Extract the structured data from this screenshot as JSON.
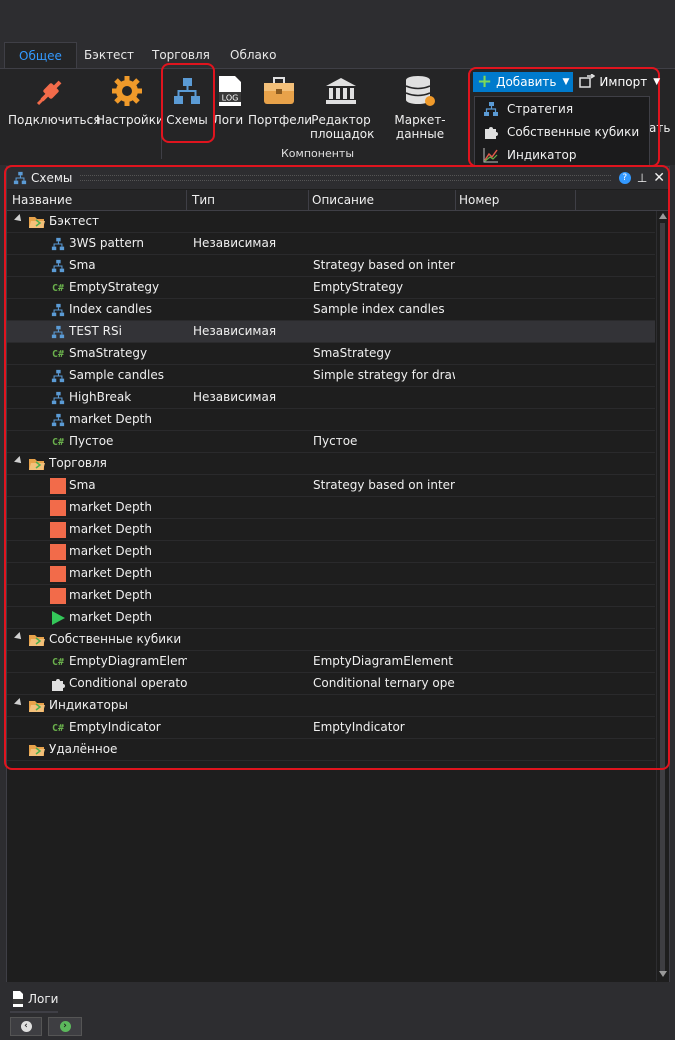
{
  "tabs": [
    {
      "label": "Общее",
      "active": true
    },
    {
      "label": "Бэктест"
    },
    {
      "label": "Торговля"
    },
    {
      "label": "Облако"
    }
  ],
  "ribbon": {
    "connect": "Подключиться",
    "settings": "Настройки",
    "schemes": "Схемы",
    "logs": "Логи",
    "portfolios": "Портфели",
    "platform_editor_1": "Редактор",
    "platform_editor_2": "площадок",
    "market_data": "Маркет-данные",
    "components_group": "Компоненты",
    "partial_label": "ать"
  },
  "toolbar": {
    "add_label": "Добавить",
    "import_label": "Импорт"
  },
  "add_menu": [
    {
      "label": "Стратегия",
      "icon": "strategy-icon"
    },
    {
      "label": "Собственные кубики",
      "icon": "puzzle-icon"
    },
    {
      "label": "Индикатор",
      "icon": "indicator-icon"
    }
  ],
  "panel": {
    "title": "Схемы"
  },
  "columns": [
    "Название",
    "Тип",
    "Описание",
    "Номер"
  ],
  "tree": [
    {
      "kind": "group",
      "name": "Бэктест"
    },
    {
      "kind": "item",
      "icon": "scheme",
      "name": "3WS pattern",
      "type": "Независимая",
      "desc": ""
    },
    {
      "kind": "item",
      "icon": "scheme",
      "name": "Sma",
      "type": "",
      "desc": "Strategy based on inters..."
    },
    {
      "kind": "item",
      "icon": "csharp",
      "name": "EmptyStrategy",
      "type": "",
      "desc": "EmptyStrategy"
    },
    {
      "kind": "item",
      "icon": "scheme",
      "name": "Index candles",
      "type": "",
      "desc": "Sample index candles"
    },
    {
      "kind": "item",
      "icon": "scheme",
      "name": "TEST RSi",
      "type": "Независимая",
      "desc": "",
      "selected": true
    },
    {
      "kind": "item",
      "icon": "csharp",
      "name": "SmaStrategy",
      "type": "",
      "desc": "SmaStrategy"
    },
    {
      "kind": "item",
      "icon": "scheme",
      "name": "Sample candles",
      "type": "",
      "desc": "Simple strategy for draw..."
    },
    {
      "kind": "item",
      "icon": "scheme",
      "name": "HighBreak",
      "type": "Независимая",
      "desc": ""
    },
    {
      "kind": "item",
      "icon": "scheme",
      "name": "market Depth",
      "type": "",
      "desc": ""
    },
    {
      "kind": "item",
      "icon": "csharp",
      "name": "Пустое",
      "type": "",
      "desc": "Пустое"
    },
    {
      "kind": "group",
      "name": "Торговля"
    },
    {
      "kind": "item",
      "icon": "stopped",
      "name": "Sma",
      "type": "",
      "desc": "Strategy based on inters..."
    },
    {
      "kind": "item",
      "icon": "stopped",
      "name": "market Depth",
      "type": "",
      "desc": ""
    },
    {
      "kind": "item",
      "icon": "stopped",
      "name": "market Depth",
      "type": "",
      "desc": ""
    },
    {
      "kind": "item",
      "icon": "stopped",
      "name": "market Depth",
      "type": "",
      "desc": ""
    },
    {
      "kind": "item",
      "icon": "stopped",
      "name": "market Depth",
      "type": "",
      "desc": ""
    },
    {
      "kind": "item",
      "icon": "stopped",
      "name": "market Depth",
      "type": "",
      "desc": ""
    },
    {
      "kind": "item",
      "icon": "running",
      "name": "market Depth",
      "type": "",
      "desc": ""
    },
    {
      "kind": "group",
      "name": "Собственные кубики"
    },
    {
      "kind": "item",
      "icon": "csharp",
      "name": "EmptyDiagramElement",
      "type": "",
      "desc": "EmptyDiagramElement"
    },
    {
      "kind": "item",
      "icon": "puzzle",
      "name": "Conditional operator",
      "type": "",
      "desc": "Conditional ternary oper..."
    },
    {
      "kind": "group",
      "name": "Индикаторы"
    },
    {
      "kind": "item",
      "icon": "csharp",
      "name": "EmptyIndicator",
      "type": "",
      "desc": "EmptyIndicator"
    },
    {
      "kind": "group",
      "name": "Удалённое",
      "noexpand": true
    }
  ],
  "bottom": {
    "logs_tab": "Логи"
  },
  "colors": {
    "accent": "#007acc",
    "stopped": "#f26b4a",
    "running": "#34c759",
    "highlight_box": "#e0141e",
    "folder": "#e8a24a"
  }
}
